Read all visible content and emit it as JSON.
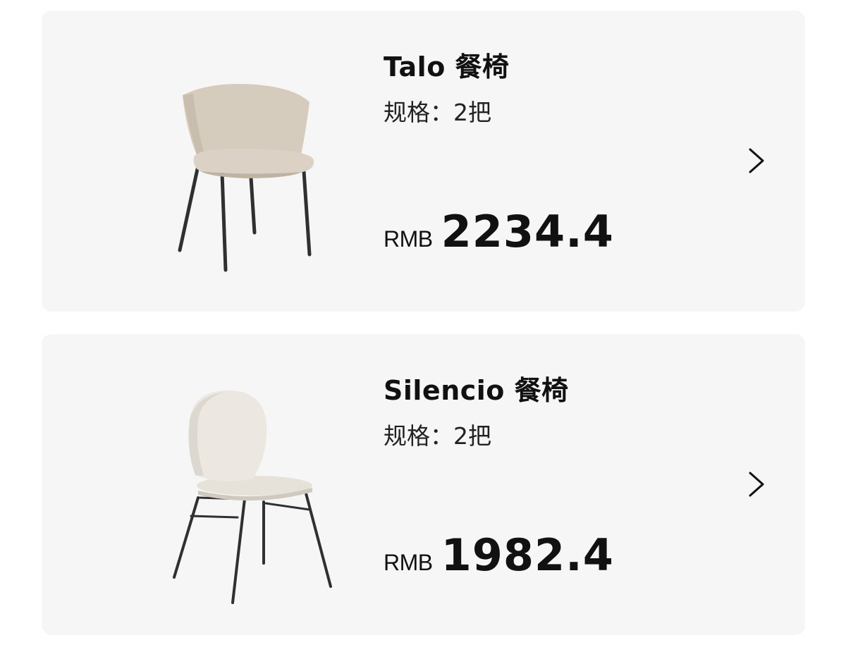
{
  "products": [
    {
      "name": "Talo 餐椅",
      "spec": "规格：2把",
      "currency": "RMB",
      "price": "2234.4",
      "image_icon": "dining-chair-upholstered-icon",
      "image_color": "#d9d0c3"
    },
    {
      "name": "Silencio 餐椅",
      "spec": "规格：2把",
      "currency": "RMB",
      "price": "1982.4",
      "image_icon": "dining-chair-round-back-icon",
      "image_color": "#ece8e1"
    }
  ],
  "chevron_icon": "chevron-right-icon",
  "colors": {
    "card_background": "#f6f6f6",
    "text": "#111111",
    "chair_legs": "#2f3032"
  }
}
